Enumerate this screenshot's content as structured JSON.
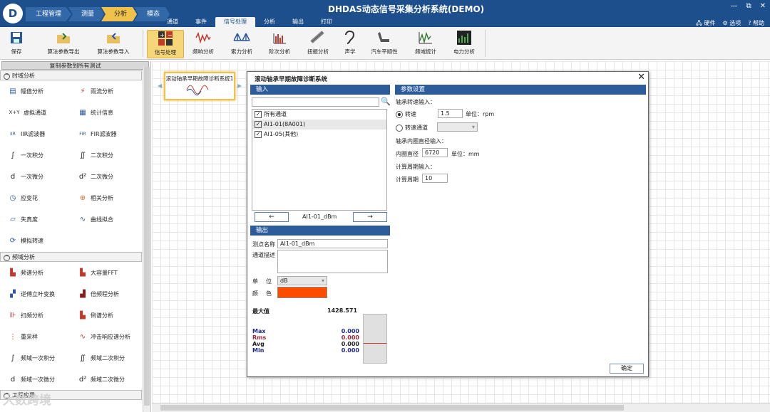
{
  "app": {
    "logo": "D",
    "title": "DHDAS动态信号采集分析系统(DEMO)"
  },
  "workflow": [
    "工程管理",
    "测量",
    "分析",
    "模态"
  ],
  "window_controls": [
    "—",
    "⧉",
    "✕"
  ],
  "top_right": {
    "hardware": "硬件",
    "options": "选项",
    "help": "帮助"
  },
  "tabs": [
    "通道",
    "事件",
    "信号处理",
    "分析",
    "输出",
    "打印"
  ],
  "ribbon": {
    "left": [
      {
        "label": "保存",
        "icon": "save-icon"
      },
      {
        "label": "算法参数导出",
        "icon": "export-icon"
      },
      {
        "label": "算法参数导入",
        "icon": "import-icon"
      }
    ],
    "main": [
      {
        "label": "信号处理",
        "icon": "calc-icon"
      },
      {
        "label": "频响分析",
        "icon": "freq-icon"
      },
      {
        "label": "索力分析",
        "icon": "bridge-icon"
      },
      {
        "label": "阶次分析",
        "icon": "order-icon"
      },
      {
        "label": "扭振分析",
        "icon": "torsion-icon"
      },
      {
        "label": "声学",
        "icon": "ear-icon"
      },
      {
        "label": "汽车平顺性",
        "icon": "seat-icon"
      },
      {
        "label": "频域统计",
        "icon": "stat-icon"
      },
      {
        "label": "电力分析",
        "icon": "power-icon"
      }
    ]
  },
  "sidebar": {
    "copy_all": "复制参数到所有测试",
    "time_section": "时域分析",
    "time_items": [
      "幅值分析",
      "雨流分析",
      "虚拟通道",
      "统计信息",
      "IIR滤波器",
      "FIR滤波器",
      "一次积分",
      "二次积分",
      "一次微分",
      "二次微分",
      "应变花",
      "相关分析",
      "失真度",
      "曲线拟合",
      "模拟转速"
    ],
    "time_icons": [
      "▤",
      "⚡",
      "X+Y",
      "▦",
      "IIR",
      "FIR",
      "∫",
      "∬",
      "d",
      "d²",
      "◷",
      "⊕",
      "▱",
      "∿",
      "⟳"
    ],
    "freq_section": "频域分析",
    "freq_items": [
      "频谱分析",
      "大容量FFT",
      "逆傅立叶变换",
      "倍频程分析",
      "扫频分析",
      "倒谱分析",
      "重采样",
      "冲击响应谱分析",
      "频域一次积分",
      "频域二次积分",
      "频域一次微分",
      "频域二次微分"
    ],
    "freq_icons": [
      "▙",
      "▙",
      "▞",
      "▟",
      "⊪",
      "▙",
      "⋮",
      "∿",
      "∫",
      "∬",
      "d",
      "d²"
    ],
    "eng_section": "工程应用"
  },
  "canvas": {
    "node_title": "滚动轴承早期故障诊断系统1"
  },
  "dialog": {
    "title": "滚动轴承早期故障诊断系统",
    "close": "✕",
    "input_header": "输入",
    "search_value": "",
    "channels": [
      {
        "label": "所有通道",
        "checked": true
      },
      {
        "label": "AI1-01(8A001)",
        "checked": true
      },
      {
        "label": "AI1-05(其他)",
        "checked": true
      }
    ],
    "nav_prev": "←",
    "nav_label": "AI1-01_dBm",
    "nav_next": "→",
    "output_header": "输出",
    "point_name_label": "测点名称",
    "point_name_value": "AI1-01_dBm",
    "channel_desc_label": "通道描述",
    "unit_label_a": "单",
    "unit_label_b": "位",
    "unit_value": "dB",
    "color_label_a": "颜",
    "color_label_b": "色",
    "color_value": "#ff4d00",
    "max_label": "最大值",
    "max_value": "1428.571",
    "stats": [
      {
        "label": "Max",
        "value": "0.000",
        "color": "#1c2a8c"
      },
      {
        "label": "Rms",
        "value": "0.000",
        "color": "#a0283c"
      },
      {
        "label": "Avg",
        "value": "0.000",
        "color": "#222222"
      },
      {
        "label": "Min",
        "value": "0.000",
        "color": "#1c2a8c"
      }
    ],
    "params_header": "参数设置",
    "speed_input_label": "轴承转速输入：",
    "speed_label": "转速",
    "speed_value": "1.5",
    "speed_unit": "单位：rpm",
    "speed_channel_label": "转速通道",
    "inner_dia_label": "轴承内圈直径输入：",
    "inner_dia_field": "内圈直径",
    "inner_dia_value": "6720",
    "inner_dia_unit": "单位：mm",
    "period_label": "计算周期输入：",
    "period_field": "计算周期",
    "period_value": "10",
    "ok": "确定"
  },
  "watermark": "大数跨境"
}
